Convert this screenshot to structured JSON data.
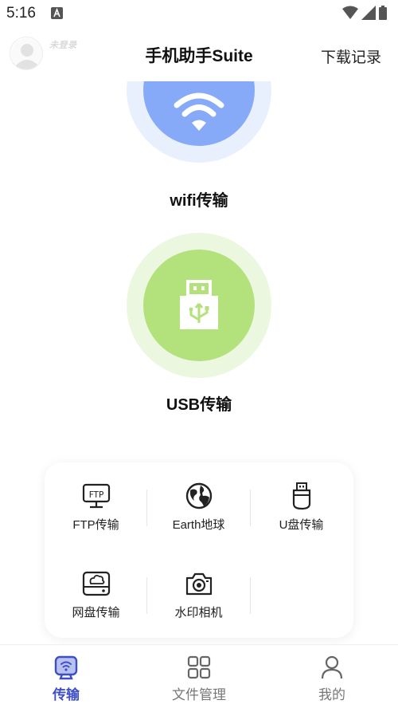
{
  "status_bar": {
    "time": "5:16",
    "icons": [
      "notification-a-icon",
      "wifi-signal-icon",
      "cell-signal-icon",
      "battery-icon"
    ]
  },
  "header": {
    "login_status": "未登录",
    "title": "手机助手Suite",
    "download_records": "下载记录"
  },
  "main": {
    "wifi_label": "wifi传输",
    "usb_label": "USB传输"
  },
  "tools": [
    {
      "label": "FTP传输",
      "icon": "ftp-icon"
    },
    {
      "label": "Earth地球",
      "icon": "globe-icon"
    },
    {
      "label": "U盘传输",
      "icon": "usb-drive-icon"
    },
    {
      "label": "网盘传输",
      "icon": "cloud-drive-icon"
    },
    {
      "label": "水印相机",
      "icon": "camera-icon"
    }
  ],
  "tabbar": {
    "tabs": [
      {
        "label": "传输",
        "icon": "transfer-icon",
        "active": true
      },
      {
        "label": "文件管理",
        "icon": "grid-icon",
        "active": false
      },
      {
        "label": "我的",
        "icon": "user-icon",
        "active": false
      }
    ]
  },
  "colors": {
    "wifi_circle": "#86aaf7",
    "wifi_halo": "#e9f0fd",
    "usb_circle": "#b3e27c",
    "usb_halo": "#ebf7df",
    "active_tab": "#3d4ec7"
  }
}
